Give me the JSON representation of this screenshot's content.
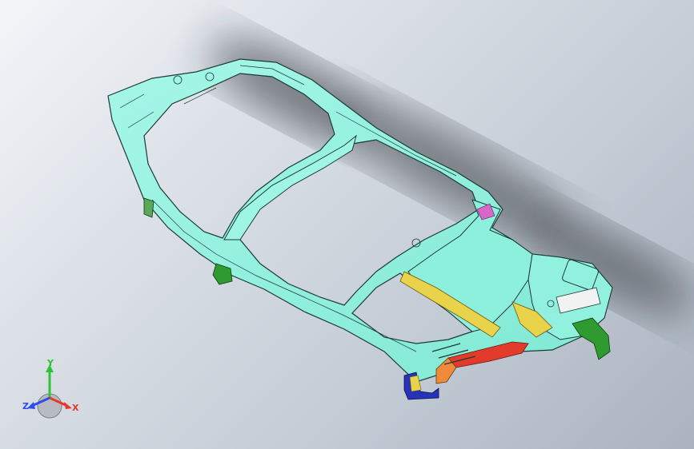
{
  "viewport": {
    "background_top": "#f3f5f8",
    "background_bottom": "#aab3bf"
  },
  "model": {
    "part_icon": "car-body-frame-icon",
    "colors": {
      "frame": "#8ff3df",
      "frame_edge": "#1b3a36",
      "shadow": "#1e2226",
      "bracket_green": "#2f9a2f",
      "rail_yellow": "#e9d34a",
      "rail_red": "#e23b2b",
      "rail_orange": "#ee8a3a",
      "block_blue": "#2433b8",
      "accent_magenta": "#d768c7"
    }
  },
  "triad": {
    "icon": "coordinate-triad-icon",
    "y_label": "Y",
    "z_label": "Z",
    "x_label": "X",
    "y_color": "#2ec23a",
    "z_color": "#2f4cf0",
    "x_color": "#e23b2b"
  }
}
